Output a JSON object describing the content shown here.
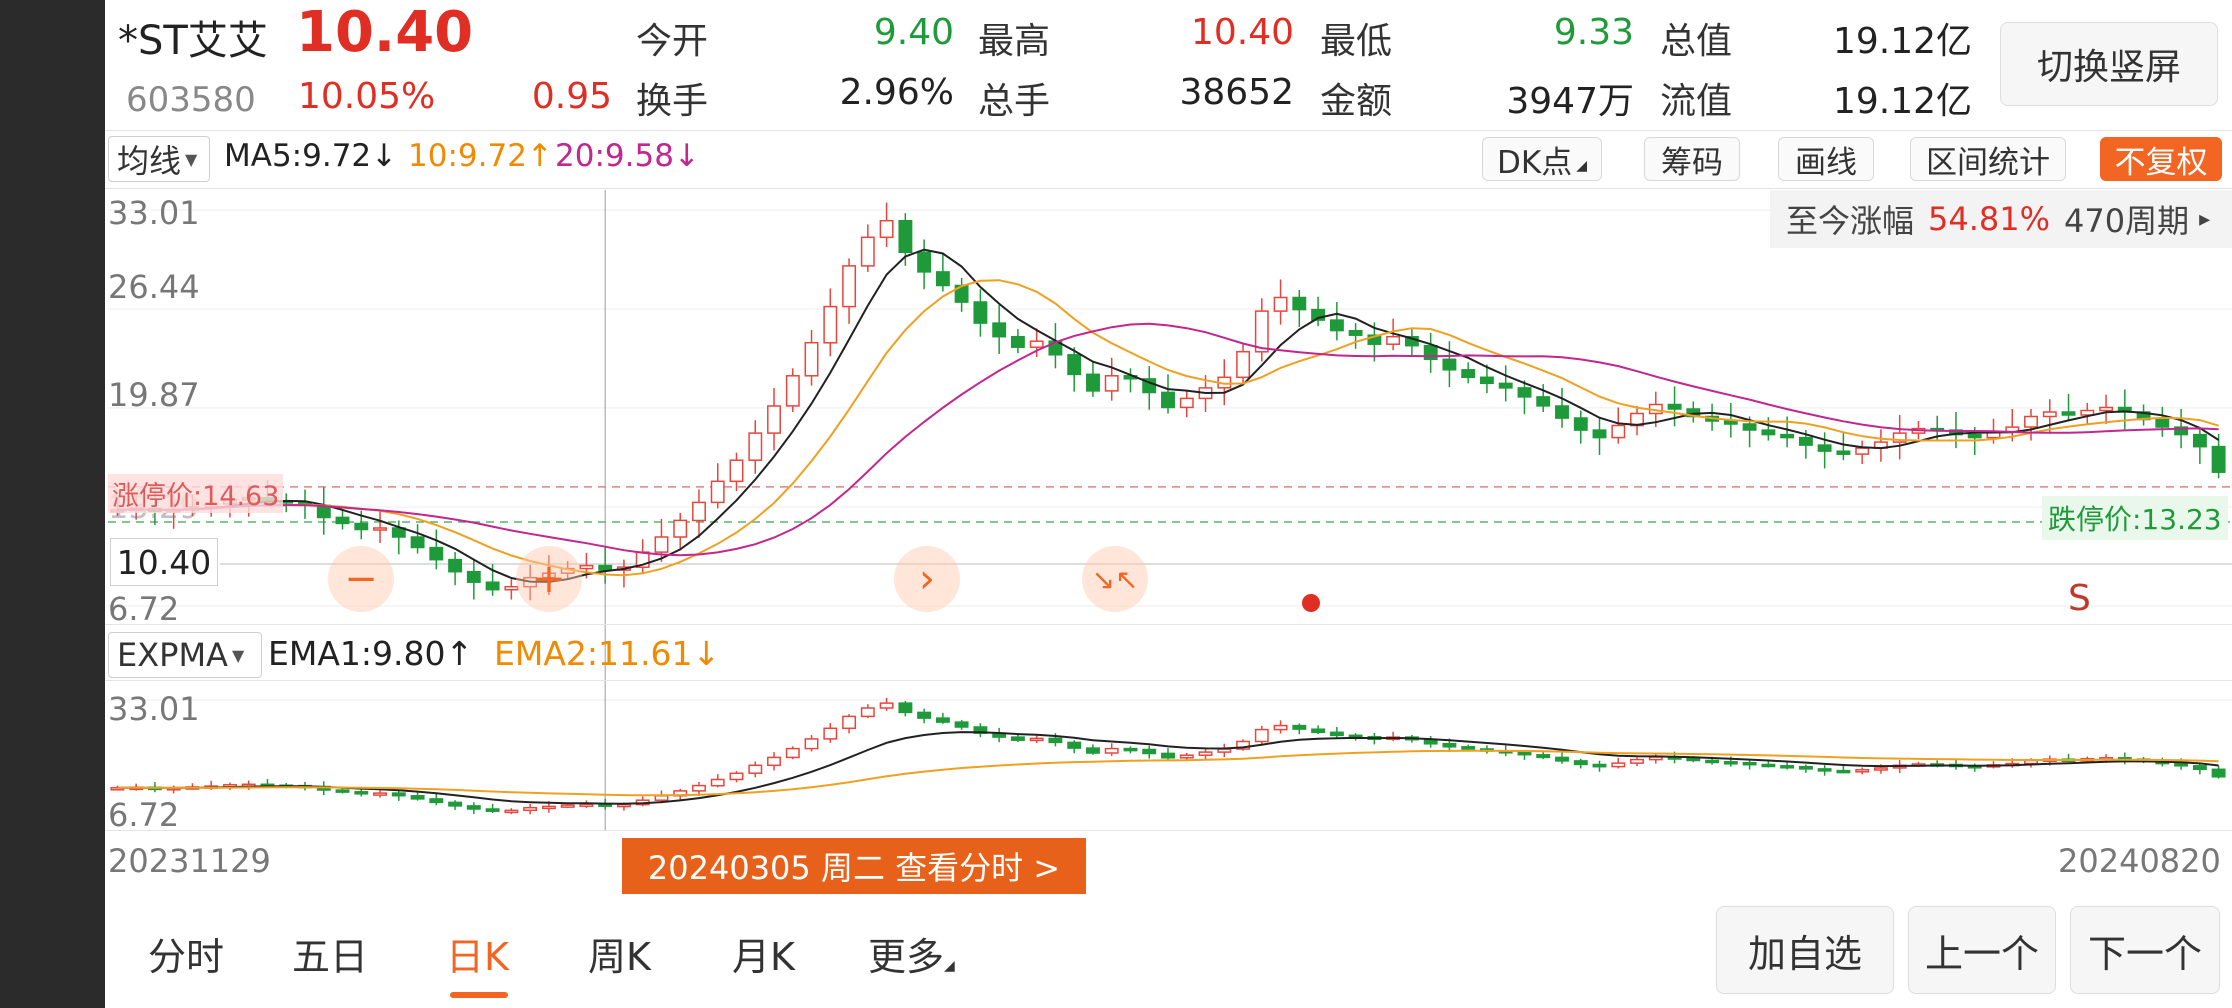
{
  "header": {
    "name": "*ST艾艾",
    "price": "10.40",
    "code": "603580",
    "change_pct": "10.05%",
    "change_amt": "0.95",
    "stats": [
      {
        "label": "今开",
        "value": "9.40",
        "color": "#1f9a3a"
      },
      {
        "label": "最高",
        "value": "10.40",
        "color": "#e02e24"
      },
      {
        "label": "最低",
        "value": "9.33",
        "color": "#1f9a3a"
      },
      {
        "label": "总值",
        "value": "19.12亿",
        "color": "#222222"
      },
      {
        "label": "换手",
        "value": "2.96%",
        "color": "#222222"
      },
      {
        "label": "总手",
        "value": "38652",
        "color": "#222222"
      },
      {
        "label": "金额",
        "value": "3947万",
        "color": "#222222"
      },
      {
        "label": "流值",
        "value": "19.12亿",
        "color": "#222222"
      }
    ],
    "switch_button": "切换竖屏"
  },
  "toolbar": {
    "ma_select": "均线",
    "ma5": "MA5:9.72↓",
    "ma10": "10:9.72↑",
    "ma20": "20:9.58↓",
    "dk": "DK点",
    "chips": "筹码",
    "draw": "画线",
    "range": "区间统计",
    "adjust": "不复权"
  },
  "main_chart": {
    "y_labels": [
      "33.01",
      "26.44",
      "19.87",
      "13.29",
      "6.72"
    ],
    "gain_label": "至今涨幅",
    "gain_value": "54.81%",
    "gain_period": "470周期",
    "limit_up": "涨停价:14.63",
    "limit_down": "跌停价:13.23",
    "current_price": "10.40",
    "controls": [
      "−",
      "+",
      "›",
      "↘↖"
    ],
    "sell_mark": "S"
  },
  "sub_chart": {
    "indicator": "EXPMA",
    "ema1": "EMA1:9.80↑",
    "ema2": "EMA2:11.61↓",
    "y_labels": [
      "33.01",
      "6.72"
    ]
  },
  "dates": {
    "start": "20231129",
    "end": "20240820",
    "tooltip": "20240305 周二 查看分时 >"
  },
  "bottom_tabs": [
    "分时",
    "五日",
    "日K",
    "周K",
    "月K",
    "更多"
  ],
  "active_tab": "日K",
  "bottom_buttons": [
    "加自选",
    "上一个",
    "下一个"
  ],
  "chart_data": {
    "type": "candlestick",
    "title": "",
    "ylim": [
      6.72,
      33.01
    ],
    "y_ticks": [
      33.01,
      26.44,
      19.87,
      13.29,
      6.72
    ],
    "x_start": "20231129",
    "x_end": "20240820",
    "closes": [
      13.1,
      13.2,
      13.0,
      13.1,
      13.3,
      13.5,
      13.8,
      13.9,
      13.7,
      13.6,
      13.4,
      12.6,
      12.2,
      11.8,
      11.9,
      11.3,
      10.6,
      9.8,
      9.0,
      8.3,
      7.8,
      8.0,
      8.6,
      8.9,
      9.2,
      9.4,
      9.1,
      9.3,
      10.3,
      11.3,
      12.4,
      13.6,
      15.0,
      16.4,
      18.2,
      20.0,
      22.0,
      24.2,
      26.6,
      29.3,
      31.2,
      32.3,
      30.2,
      28.9,
      28.0,
      26.9,
      25.5,
      24.6,
      23.9,
      24.3,
      23.4,
      22.1,
      21.0,
      22.0,
      21.8,
      20.9,
      19.9,
      20.5,
      21.2,
      21.9,
      23.6,
      26.3,
      27.2,
      26.4,
      25.7,
      25.0,
      24.7,
      24.1,
      24.6,
      24.0,
      23.1,
      22.4,
      21.9,
      21.5,
      21.2,
      20.6,
      20.0,
      19.2,
      18.4,
      17.9,
      18.7,
      19.5,
      20.1,
      19.8,
      19.3,
      19.0,
      18.8,
      18.4,
      18.1,
      17.9,
      17.4,
      17.0,
      16.8,
      17.2,
      17.6,
      18.2,
      18.5,
      18.4,
      18.1,
      17.9,
      18.3,
      18.6,
      19.3,
      19.6,
      19.4,
      19.7,
      19.9,
      19.6,
      19.1,
      18.6,
      18.1,
      17.3,
      15.6
    ]
  }
}
